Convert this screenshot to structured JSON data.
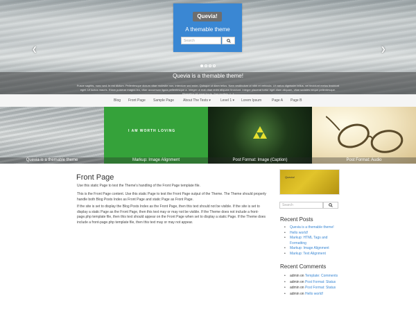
{
  "hero": {
    "site_title": "Quevia!",
    "site_desc": "A themable theme",
    "search_placeholder": "Search",
    "caption_title": "Quevia is a themable theme!",
    "caption_text": "Fusce sagittis, nunc sed. In est dictum. Pellentesque dictum vitae molestie non, interdum sed enim. Quisque ut diam tellus. Nam vestibulum ut nibh et vehicula. Ut varius dignissim tellus, vel tincidunt metus tincidunt eget. Ut luctus mauris. Etiam pulvinar magna leo, vitae accumsan ligula pellentesque a. Integer ut erat vitae enim aliquam tincidunt. Integer placerat tortor eget diam aliquam, vitae sodales neque pellentesque. Phasellus sit amet ligula. Sed facilisis. [...]",
    "slides": 4,
    "active_slide": 1
  },
  "nav": [
    "Blog",
    "Front Page",
    "Sample Page",
    "About The Tests ▾",
    "Level 1 ▾",
    "Lorem Ipsum",
    "Page A",
    "Page B"
  ],
  "strip": {
    "item1": "Quevia is a themable theme",
    "item2": "Markup: Image Alignment",
    "item3": "Post Format: Image (Caption)",
    "item4": "Post Format: Audio",
    "loving_text": "I AM WORTH LOVING",
    "loving_sub": "..."
  },
  "content": {
    "title": "Front Page",
    "p1": "Use this static Page to test the Theme's handling of the Front Page template file.",
    "p2": "This is the Front Page content. Use this static Page to test the Front Page output of the Theme. The Theme should properly handle both Blog Posts Index as Front Page and static Page as Front Page.",
    "p3": "If the site is set to display the Blog Posts Index as the Front Page, then this text should not be visible. If the site is set to display a static Page as the Front Page, then this text may or may not be visible. If the Theme does not include a front-page.php template file, then this text should appear on the Front Page when set to display a static Page. If the Theme does include a front-page.php template file, then this text may or may not appear."
  },
  "sidebar": {
    "image_label": "Quevia!",
    "search_placeholder": "Search",
    "recent_posts_title": "Recent Posts",
    "recent_posts": [
      "Quevia is a themable theme!",
      "Hello world!",
      "Markup: HTML Tags and Formatting",
      "Markup: Image Alignment",
      "Markup: Text Alignment"
    ],
    "recent_comments_title": "Recent Comments",
    "recent_comments": [
      {
        "author": "admin",
        "on": "on",
        "post": "Template: Comments"
      },
      {
        "author": "admin",
        "on": "on",
        "post": "Post Format: Status"
      },
      {
        "author": "admin",
        "on": "on",
        "post": "Post Format: Status"
      },
      {
        "author": "admin",
        "on": "on",
        "post": "Hello world!"
      }
    ]
  },
  "colors": {
    "brand": "#3a87d3",
    "green": "#35a23a",
    "gold": "#d4b521"
  }
}
